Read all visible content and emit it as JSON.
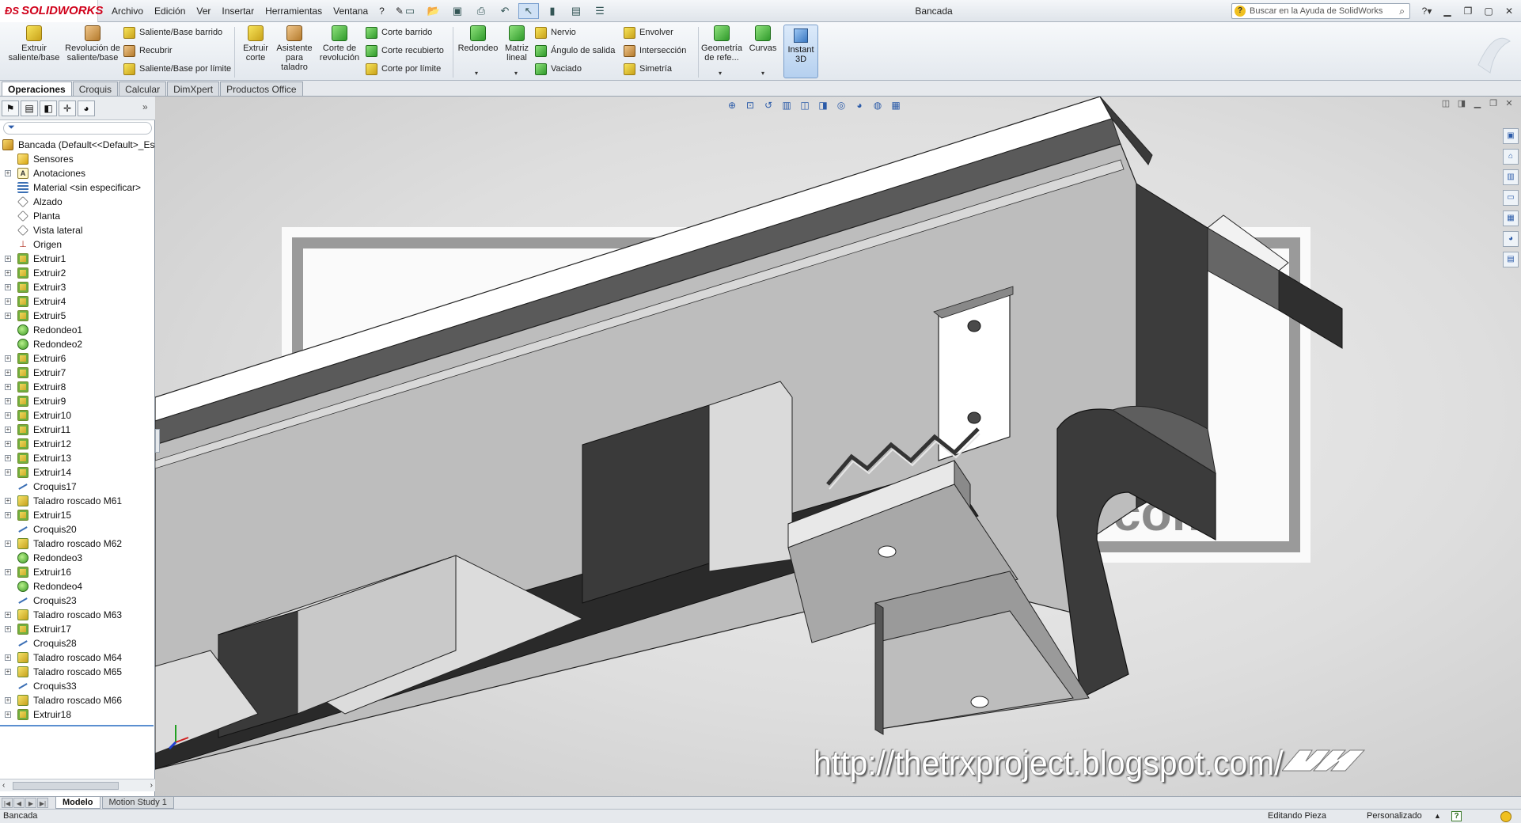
{
  "app": {
    "brand": "SOLIDWORKS",
    "document_title": "Bancada",
    "menu": [
      "Archivo",
      "Edición",
      "Ver",
      "Insertar",
      "Herramientas",
      "Ventana",
      "?"
    ],
    "help_search_placeholder": "Buscar en la Ayuda de SolidWorks"
  },
  "ribbon": {
    "extrude_boss": "Extruir saliente/base",
    "revolve_boss": "Revolución de saliente/base",
    "swept_boss": "Saliente/Base barrido",
    "loft": "Recubrir",
    "boundary_boss": "Saliente/Base por límite",
    "extrude_cut": "Extruir corte",
    "hole_wizard": "Asistente para taladro",
    "revolve_cut": "Corte de revolución",
    "swept_cut": "Corte barrido",
    "lofted_cut": "Corte recubierto",
    "boundary_cut": "Corte por límite",
    "fillet": "Redondeo",
    "linear_pattern": "Matriz lineal",
    "rib": "Nervio",
    "draft": "Ángulo de salida",
    "shell": "Vaciado",
    "wrap": "Envolver",
    "intersect": "Intersección",
    "mirror": "Simetría",
    "ref_geometry": "Geometría de refe...",
    "curves": "Curvas",
    "instant3d": "Instant 3D"
  },
  "command_tabs": [
    "Operaciones",
    "Croquis",
    "Calcular",
    "DimXpert",
    "Productos Office"
  ],
  "feature_tree": {
    "root": "Bancada  (Default<<Default>_Es",
    "items": [
      {
        "label": "Sensores",
        "icon": "sensor-icon",
        "exp": false
      },
      {
        "label": "Anotaciones",
        "icon": "annotations-icon",
        "exp": true
      },
      {
        "label": "Material <sin especificar>",
        "icon": "material-icon",
        "exp": false
      },
      {
        "label": "Alzado",
        "icon": "plane-icon",
        "exp": false
      },
      {
        "label": "Planta",
        "icon": "plane-icon",
        "exp": false
      },
      {
        "label": "Vista lateral",
        "icon": "plane-icon",
        "exp": false
      },
      {
        "label": "Origen",
        "icon": "origin-icon",
        "exp": false
      },
      {
        "label": "Extruir1",
        "icon": "extrude-icon",
        "exp": true
      },
      {
        "label": "Extruir2",
        "icon": "extrude-icon",
        "exp": true
      },
      {
        "label": "Extruir3",
        "icon": "extrude-icon",
        "exp": true
      },
      {
        "label": "Extruir4",
        "icon": "extrude-icon",
        "exp": true
      },
      {
        "label": "Extruir5",
        "icon": "extrude-icon",
        "exp": true
      },
      {
        "label": "Redondeo1",
        "icon": "fillet-icon",
        "exp": false
      },
      {
        "label": "Redondeo2",
        "icon": "fillet-icon",
        "exp": false
      },
      {
        "label": "Extruir6",
        "icon": "extrude-icon",
        "exp": true
      },
      {
        "label": "Extruir7",
        "icon": "extrude-icon",
        "exp": true
      },
      {
        "label": "Extruir8",
        "icon": "extrude-icon",
        "exp": true
      },
      {
        "label": "Extruir9",
        "icon": "extrude-icon",
        "exp": true
      },
      {
        "label": "Extruir10",
        "icon": "extrude-icon",
        "exp": true
      },
      {
        "label": "Extruir11",
        "icon": "extrude-icon",
        "exp": true
      },
      {
        "label": "Extruir12",
        "icon": "extrude-icon",
        "exp": true
      },
      {
        "label": "Extruir13",
        "icon": "extrude-icon",
        "exp": true
      },
      {
        "label": "Extruir14",
        "icon": "extrude-icon",
        "exp": true
      },
      {
        "label": "Croquis17",
        "icon": "sketch-icon",
        "exp": false
      },
      {
        "label": "Taladro roscado M61",
        "icon": "hole-icon",
        "exp": true
      },
      {
        "label": "Extruir15",
        "icon": "extrude-icon",
        "exp": true
      },
      {
        "label": "Croquis20",
        "icon": "sketch-icon",
        "exp": false
      },
      {
        "label": "Taladro roscado M62",
        "icon": "hole-icon",
        "exp": true
      },
      {
        "label": "Redondeo3",
        "icon": "fillet-icon",
        "exp": false
      },
      {
        "label": "Extruir16",
        "icon": "extrude-icon",
        "exp": true
      },
      {
        "label": "Redondeo4",
        "icon": "fillet-icon",
        "exp": false
      },
      {
        "label": "Croquis23",
        "icon": "sketch-icon",
        "exp": false
      },
      {
        "label": "Taladro roscado M63",
        "icon": "hole-icon",
        "exp": true
      },
      {
        "label": "Extruir17",
        "icon": "extrude-icon",
        "exp": true
      },
      {
        "label": "Croquis28",
        "icon": "sketch-icon",
        "exp": false
      },
      {
        "label": "Taladro roscado M64",
        "icon": "hole-icon",
        "exp": true
      },
      {
        "label": "Taladro roscado M65",
        "icon": "hole-icon",
        "exp": true
      },
      {
        "label": "Croquis33",
        "icon": "sketch-icon",
        "exp": false
      },
      {
        "label": "Taladro roscado M66",
        "icon": "hole-icon",
        "exp": true
      },
      {
        "label": "Extruir18",
        "icon": "extrude-icon",
        "exp": true
      }
    ]
  },
  "viewport": {
    "watermark_url": "http://thetrxproject.blogspot.com/",
    "background_text": "com"
  },
  "bottom_tabs": [
    "Modelo",
    "Motion Study 1"
  ],
  "status": {
    "left": "Bancada",
    "mode": "Editando Pieza",
    "units": "Personalizado"
  }
}
